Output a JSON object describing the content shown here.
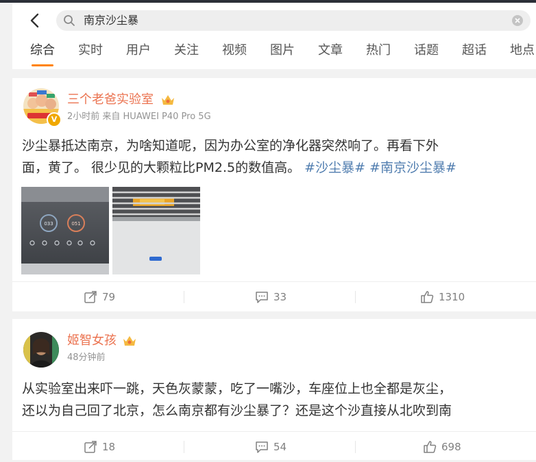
{
  "search": {
    "query": "南京沙尘暴"
  },
  "tabs": [
    "综合",
    "实时",
    "用户",
    "关注",
    "视频",
    "图片",
    "文章",
    "热门",
    "话题",
    "超话",
    "地点"
  ],
  "posts": [
    {
      "username": "三个老爸实验室",
      "meta": "2小时前 来自 HUAWEI P40 Pro 5G",
      "text_line1": "沙尘暴抵达南京，为啥知道呢，因为办公室的净化器突然响了。再看下外",
      "text_line2": "面，黄了。 很少见的大颗粒比PM2.5的数值高。 ",
      "topic1": "#沙尘暴#",
      "topic2": "#南京沙尘暴#",
      "image1_readings": [
        "033",
        "051"
      ],
      "reposts": "79",
      "comments": "33",
      "likes": "1310"
    },
    {
      "username": "姬智女孩",
      "meta": "48分钟前",
      "text_line1": "从实验室出来吓一跳，天色灰蒙蒙，吃了一嘴沙，车座位上也全都是灰尘，",
      "text_line2": "还以为自己回了北京，怎么南京都有沙尘暴了？还是这个沙直接从北吹到南",
      "reposts": "18",
      "comments": "54",
      "likes": "698"
    }
  ],
  "colors": {
    "accent": "#ff8200",
    "username": "#eb7350",
    "topic": "#507daf"
  }
}
